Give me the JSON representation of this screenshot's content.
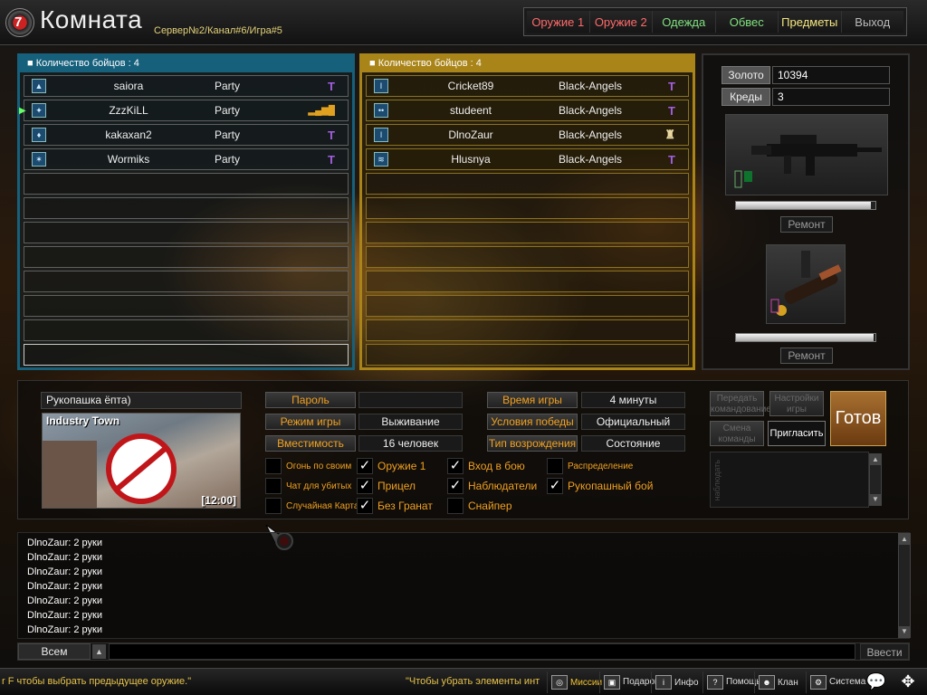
{
  "header": {
    "title": "Комната",
    "subtitle": "Сервер№2/Канал#6/Игра#5",
    "nav": [
      {
        "label": "Оружие 1",
        "color": "#ff6a6a"
      },
      {
        "label": "Оружие 2",
        "color": "#ff6a6a"
      },
      {
        "label": "Одежда",
        "color": "#7fe07f"
      },
      {
        "label": "Обвес",
        "color": "#7fe07f"
      },
      {
        "label": "Предметы",
        "color": "#f3e680"
      },
      {
        "label": "Выход",
        "color": "#bbbbbb"
      }
    ]
  },
  "teamA": {
    "header": "Количество бойцов : 4",
    "players": [
      {
        "name": "saiora",
        "clan": "Party",
        "signal": "Т"
      },
      {
        "name": "ZzzKiLL",
        "clan": "Party",
        "signal": "▂▄▆█"
      },
      {
        "name": "kakaxan2",
        "clan": "Party",
        "signal": "Т"
      },
      {
        "name": "Wormiks",
        "clan": "Party",
        "signal": "Т"
      }
    ]
  },
  "teamB": {
    "header": "Количество бойцов : 4",
    "players": [
      {
        "name": "Cricket89",
        "clan": "Black-Angels",
        "signal": "Т"
      },
      {
        "name": "studeent",
        "clan": "Black-Angels",
        "signal": "Т"
      },
      {
        "name": "DlnoZaur",
        "clan": "Black-Angels",
        "signal": "♜"
      },
      {
        "name": "Hlusnya",
        "clan": "Black-Angels",
        "signal": "Т"
      }
    ]
  },
  "shop": {
    "gold_label": "Золото",
    "gold_value": "10394",
    "credits_label": "Креды",
    "credits_value": "3",
    "repair_label": "Ремонт",
    "weapon1_durability": 0.97,
    "weapon2_durability": 0.99
  },
  "room": {
    "name": "Рукопашка ёпта)",
    "map_name": "Industry Town",
    "map_time": "[12:00]"
  },
  "settings": {
    "password_label": "Пароль",
    "password_value": "",
    "mode_label": "Режим игры",
    "mode_value": "Выживание",
    "capacity_label": "Вместимость",
    "capacity_value": "16 человек",
    "time_label": "Время игры",
    "time_value": "4 минуты",
    "win_label": "Условия победы",
    "win_value": "Официальный",
    "respawn_label": "Тип возрождения",
    "respawn_value": "Состояние",
    "options": [
      {
        "label": "Огонь по своим",
        "checked": false
      },
      {
        "label": "Оружие 1",
        "checked": true
      },
      {
        "label": "Вход в бою",
        "checked": true
      },
      {
        "label": "Распределение",
        "checked": false
      },
      {
        "label": "Чат для убитых",
        "checked": false
      },
      {
        "label": "Прицел",
        "checked": true
      },
      {
        "label": "Наблюдатели",
        "checked": true
      },
      {
        "label": "Рукопашный бой",
        "checked": true
      },
      {
        "label": "Случайная Карта",
        "checked": false
      },
      {
        "label": "Без Гранат",
        "checked": true
      },
      {
        "label": "Снайпер",
        "checked": false
      }
    ]
  },
  "actions": {
    "transfer": "Передать командование",
    "settings": "Настройки игры",
    "change_team": "Смена команды",
    "invite": "Пригласить",
    "ready": "Готов",
    "side_label": "наблюдать"
  },
  "chat": {
    "lines": [
      "DlnoZaur: 2 руки",
      "DlnoZaur: 2 руки",
      "DlnoZaur: 2 руки",
      "DlnoZaur: 2 руки",
      "DlnoZaur: 2 руки",
      "DlnoZaur: 2 руки",
      "DlnoZaur: 2 руки"
    ],
    "mode": "Всем",
    "send": "Ввести"
  },
  "bottom": {
    "tip1": "r F чтобы выбрать предыдущее оружие.\"",
    "tip2": "\"Чтобы убрать элементы инт",
    "buttons": [
      {
        "label": "Миссии"
      },
      {
        "label": "Подарок"
      },
      {
        "label": "Инфо"
      },
      {
        "label": "Помощь"
      },
      {
        "label": "Клан"
      },
      {
        "label": "Система"
      }
    ]
  }
}
